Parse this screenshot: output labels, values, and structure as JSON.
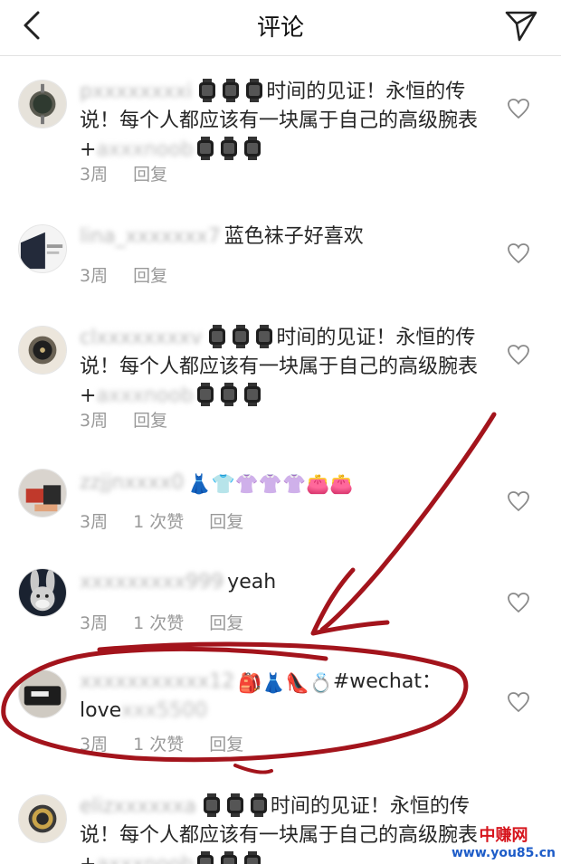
{
  "header": {
    "title": "评论"
  },
  "comments": [
    {
      "username": "pxxxxxxxxi",
      "text1": "时间的见证！永恒的传说！每个人都应该有一块属于自己的高级腕表+",
      "handle": "axxxnoob",
      "time": "3周",
      "likes": "",
      "reply": "回复"
    },
    {
      "username": "lina_xxxxxxx7",
      "text1": "蓝色袜子好喜欢",
      "time": "3周",
      "likes": "",
      "reply": "回复"
    },
    {
      "username": "clxxxxxxxxv",
      "text1": "时间的见证！永恒的传说！每个人都应该有一块属于自己的高级腕表+",
      "handle": "axxxnoob",
      "time": "3周",
      "likes": "",
      "reply": "回复"
    },
    {
      "username": "zzjjnxxxx0",
      "text1": "",
      "time": "3周",
      "likes": "1 次赞",
      "reply": "回复"
    },
    {
      "username": "xxxxxxxxx999",
      "text1": "yeah",
      "time": "3周",
      "likes": "1 次赞",
      "reply": "回复"
    },
    {
      "username": "xxxxxxxxxxx12",
      "text1": "#wechat：",
      "text2": "love",
      "handle": "xxx5500",
      "time": "3周",
      "likes": "1 次赞",
      "reply": "回复"
    },
    {
      "username": "elizxxxxxxa",
      "text1": "时间的见证！永恒的传说！每个人都应该有一块属于自己的高级腕表+",
      "handle": "axxxnoob",
      "time": "",
      "likes": "",
      "reply": ""
    }
  ],
  "watermark": {
    "brand": "中赚网",
    "url": "www.you85.cn"
  },
  "colors": {
    "annotation": "#a3141c",
    "meta": "#999999",
    "watermark_red": "#d6141c",
    "watermark_blue": "#1d5cc8"
  },
  "icons": [
    "back-chevron-icon",
    "send-paper-plane-icon",
    "heart-icon",
    "watch-emoji-icon"
  ]
}
